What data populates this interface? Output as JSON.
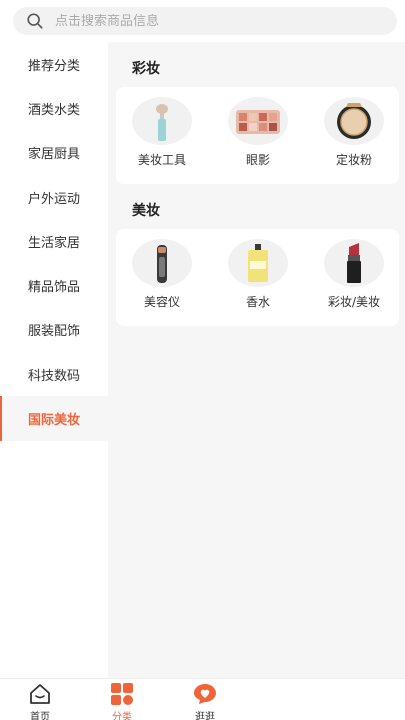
{
  "search": {
    "placeholder": "点击搜索商品信息"
  },
  "sidebar": {
    "items": [
      {
        "label": "推荐分类"
      },
      {
        "label": "酒类水类"
      },
      {
        "label": "家居厨具"
      },
      {
        "label": "户外运动"
      },
      {
        "label": "生活家居"
      },
      {
        "label": "精品饰品"
      },
      {
        "label": "服装配饰"
      },
      {
        "label": "科技数码"
      },
      {
        "label": "国际美妆"
      }
    ],
    "active_index": 8
  },
  "sections": [
    {
      "title": "彩妆",
      "items": [
        {
          "label": "美妆工具",
          "icon": "makeup-brush-icon"
        },
        {
          "label": "眼影",
          "icon": "eyeshadow-palette-icon"
        },
        {
          "label": "定妆粉",
          "icon": "powder-compact-icon"
        }
      ]
    },
    {
      "title": "美妆",
      "items": [
        {
          "label": "美容仪",
          "icon": "beauty-device-icon"
        },
        {
          "label": "香水",
          "icon": "perfume-bottle-icon"
        },
        {
          "label": "彩妆/美妆",
          "icon": "lipstick-icon"
        }
      ]
    }
  ],
  "tabbar": {
    "tabs": [
      {
        "label": "首页",
        "icon": "home-icon"
      },
      {
        "label": "分类",
        "icon": "category-grid-icon"
      },
      {
        "label": "逛逛",
        "icon": "heart-chat-icon"
      }
    ],
    "active_index": 1
  },
  "colors": {
    "accent": "#f0643a",
    "page_bg": "#f6f6f6"
  }
}
